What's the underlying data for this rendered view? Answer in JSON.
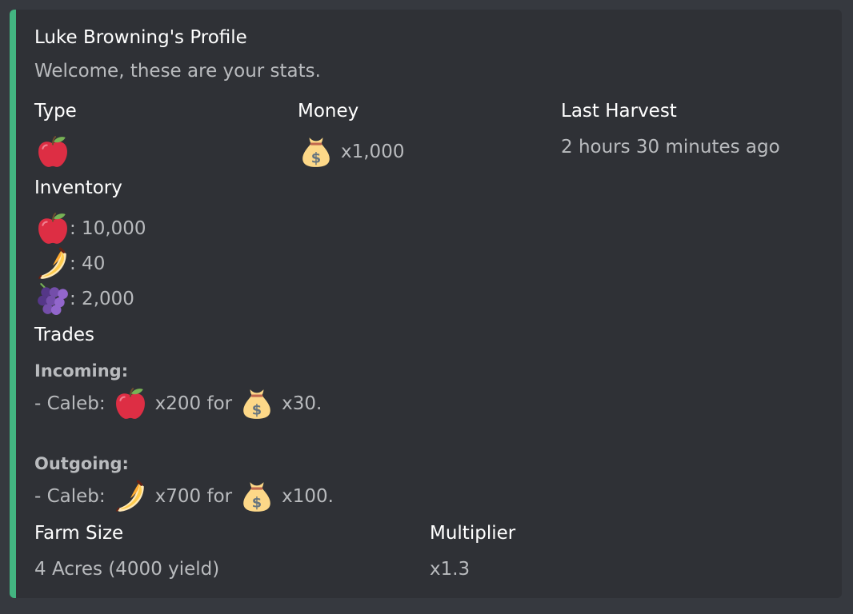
{
  "embed": {
    "accent_color": "#43b581",
    "title": "Luke Browning's Profile",
    "description": "Welcome, these are your stats."
  },
  "fields": {
    "type": {
      "name": "Type",
      "emoji": "apple-icon"
    },
    "money": {
      "name": "Money",
      "emoji": "money-bag-icon",
      "value": "x1,000"
    },
    "last_harvest": {
      "name": "Last Harvest",
      "value": "2 hours 30 minutes ago"
    },
    "inventory": {
      "name": "Inventory",
      "items": [
        {
          "emoji": "apple-icon",
          "value": ": 10,000"
        },
        {
          "emoji": "banana-icon",
          "value": ": 40"
        },
        {
          "emoji": "grapes-icon",
          "value": ": 2,000"
        }
      ]
    },
    "trades": {
      "name": "Trades",
      "incoming": {
        "heading": "Incoming:",
        "prefix": "- Caleb:",
        "give_emoji": "apple-icon",
        "give_amount": "x200 for",
        "get_emoji": "money-bag-icon",
        "get_amount": "x30."
      },
      "outgoing": {
        "heading": "Outgoing:",
        "prefix": "- Caleb:",
        "give_emoji": "banana-icon",
        "give_amount": "x700 for",
        "get_emoji": "money-bag-icon",
        "get_amount": "x100."
      }
    },
    "farm_size": {
      "name": "Farm Size",
      "value": "4 Acres (4000 yield)"
    },
    "multiplier": {
      "name": "Multiplier",
      "value": "x1.3"
    }
  }
}
